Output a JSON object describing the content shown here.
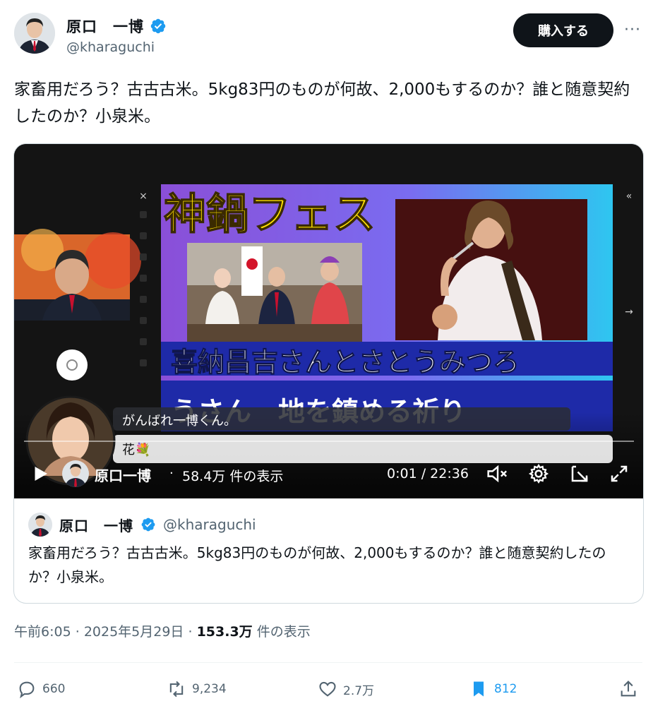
{
  "author": {
    "name": "原口　一博",
    "handle": "@kharaguchi"
  },
  "header": {
    "buy_label": "購入する",
    "more_label": "···"
  },
  "tweet": {
    "text": "家畜用だろう？古古古米。5kg83円のものが何故、2,000もするのか？誰と随意契約したのか？小泉米。"
  },
  "video": {
    "title_text": "神鍋フェス",
    "subtitle_line1": "喜納昌吉さんとさとうみつろ",
    "subtitle_line2": "うさん　地を鎮める祈り",
    "comment_1": "がんばれ一博くん。",
    "comment_2": "花💐",
    "channel_name": "原口一博",
    "views": "58.4万 件の表示",
    "time": "0:01 / 22:36"
  },
  "quote": {
    "name": "原口　一博",
    "handle": "@kharaguchi",
    "text": "家畜用だろう？古古古米。5kg83円のものが何故、2,000もするのか？誰と随意契約したのか？小泉米。"
  },
  "meta": {
    "time": "午前6:05",
    "date": "2025年5月29日",
    "views_number": "153.3万",
    "views_label": "件の表示"
  },
  "actions": {
    "replies": "660",
    "retweets": "9,234",
    "likes": "2.7万",
    "bookmarks": "812"
  },
  "colors": {
    "verified": "#1d9bf0",
    "bookmark": "#1d9bf0",
    "thumb_title": "#ffe000",
    "thumb_band": "#1e2aa8"
  }
}
